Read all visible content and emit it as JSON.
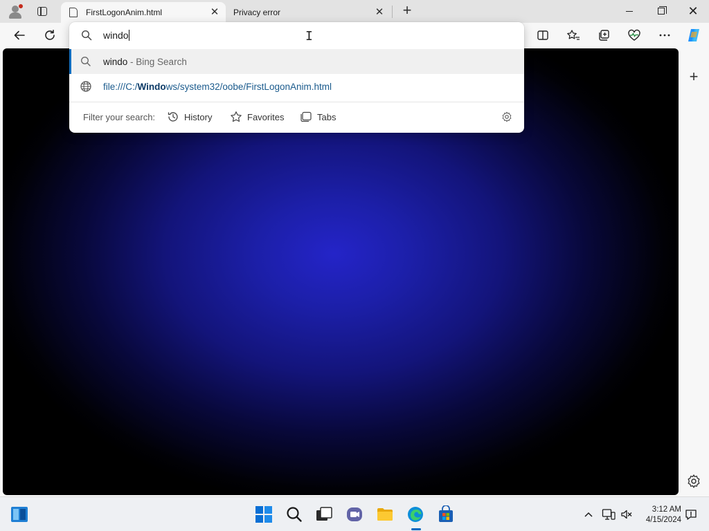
{
  "browser": {
    "tabs": [
      {
        "title": "FirstLogonAnim.html",
        "close": "✕",
        "active": true
      },
      {
        "title": "Privacy error",
        "close": "✕",
        "active": false
      }
    ],
    "new_tab_glyph": "+",
    "window_controls": {
      "close": "✕"
    }
  },
  "omnibox": {
    "query": "windo",
    "suggestions": [
      {
        "icon": "search-icon",
        "main": "windo",
        "suffix": " - Bing Search"
      },
      {
        "icon": "globe-icon",
        "url_prefix": "file:///C:/",
        "url_match": "Windo",
        "url_rest": "ws/system32/oobe/FirstLogonAnim.html"
      }
    ],
    "filter_label": "Filter your search:",
    "filters": [
      {
        "icon": "history-icon",
        "label": "History"
      },
      {
        "icon": "star-icon",
        "label": "Favorites"
      },
      {
        "icon": "tabs-icon",
        "label": "Tabs"
      }
    ]
  },
  "sidebar": {
    "add_glyph": "+"
  },
  "taskbar": {
    "time": "3:12 AM",
    "date": "4/15/2024"
  },
  "colors": {
    "accent": "#0067c0",
    "page_center": "#2424c8",
    "page_edge": "#000000"
  }
}
